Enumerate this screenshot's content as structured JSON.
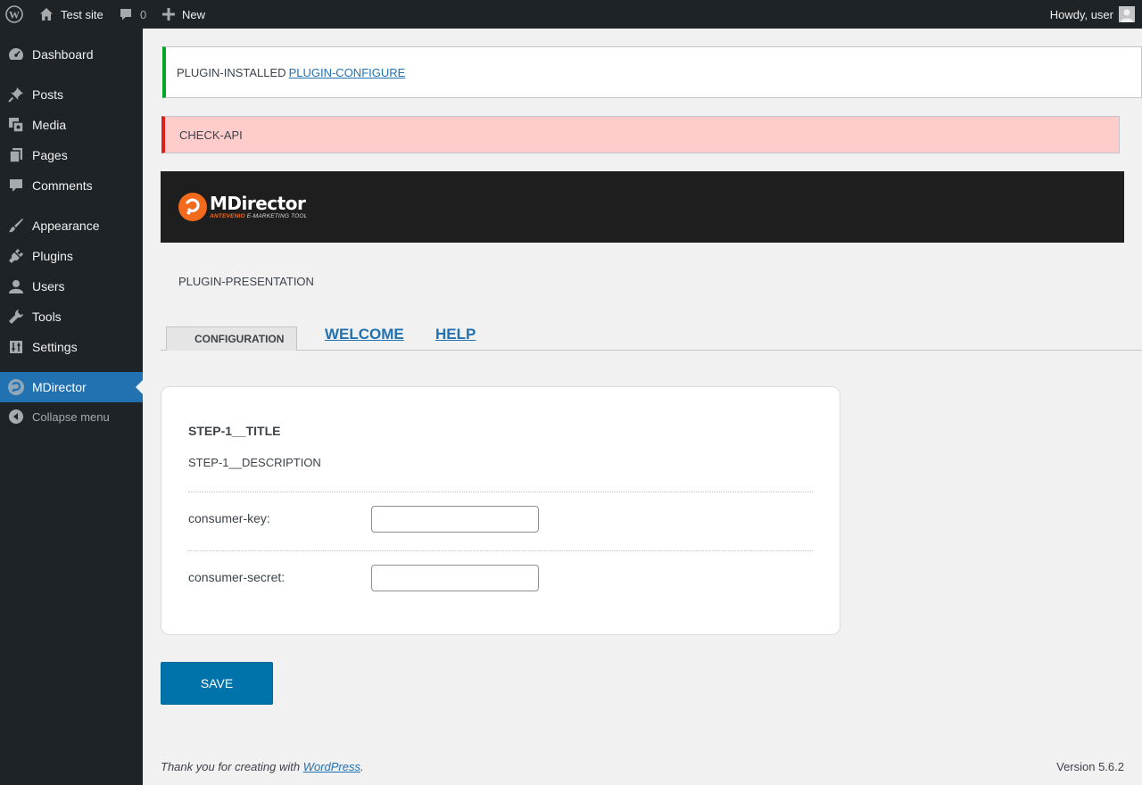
{
  "adminbar": {
    "site_name": "Test site",
    "comments_count": "0",
    "new_label": "New",
    "howdy": "Howdy, user"
  },
  "sidebar": {
    "items": [
      {
        "label": "Dashboard",
        "icon": "dashboard-icon"
      },
      {
        "label": "Posts",
        "icon": "pushpin-icon"
      },
      {
        "label": "Media",
        "icon": "media-icon"
      },
      {
        "label": "Pages",
        "icon": "pages-icon"
      },
      {
        "label": "Comments",
        "icon": "comment-icon"
      },
      {
        "label": "Appearance",
        "icon": "paintbrush-icon"
      },
      {
        "label": "Plugins",
        "icon": "plugin-icon"
      },
      {
        "label": "Users",
        "icon": "user-icon"
      },
      {
        "label": "Tools",
        "icon": "wrench-icon"
      },
      {
        "label": "Settings",
        "icon": "settings-icon"
      },
      {
        "label": "MDirector",
        "icon": "mdirector-icon"
      }
    ],
    "collapse_label": "Collapse menu"
  },
  "notices": {
    "success_text": "PLUGIN-INSTALLED",
    "success_link": "PLUGIN-CONFIGURE",
    "error_text": "CHECK-API"
  },
  "brand": {
    "name": "MDirector",
    "sub_orange": "ANTEVENIO",
    "sub_rest": "E-MARKETING TOOL"
  },
  "presentation": "PLUGIN-PRESENTATION",
  "tabs": {
    "active": "CONFIGURATION",
    "welcome": "WELCOME",
    "help": "HELP"
  },
  "form": {
    "step_title": "STEP-1__TITLE",
    "step_description": "STEP-1__DESCRIPTION",
    "consumer_key_label": "consumer-key:",
    "consumer_key_value": "",
    "consumer_secret_label": "consumer-secret:",
    "consumer_secret_value": "",
    "save_label": "SAVE"
  },
  "footer": {
    "thanks_prefix": "Thank you for creating with ",
    "thanks_link": "WordPress",
    "thanks_suffix": ".",
    "version": "Version 5.6.2"
  },
  "colors": {
    "adminbar_bg": "#1d2327",
    "accent": "#2271b1",
    "success": "#00a32a",
    "error": "#e01e1e",
    "error_bg": "#ffcccc",
    "button": "#0073aa",
    "brand_orange": "#f26b1d"
  }
}
